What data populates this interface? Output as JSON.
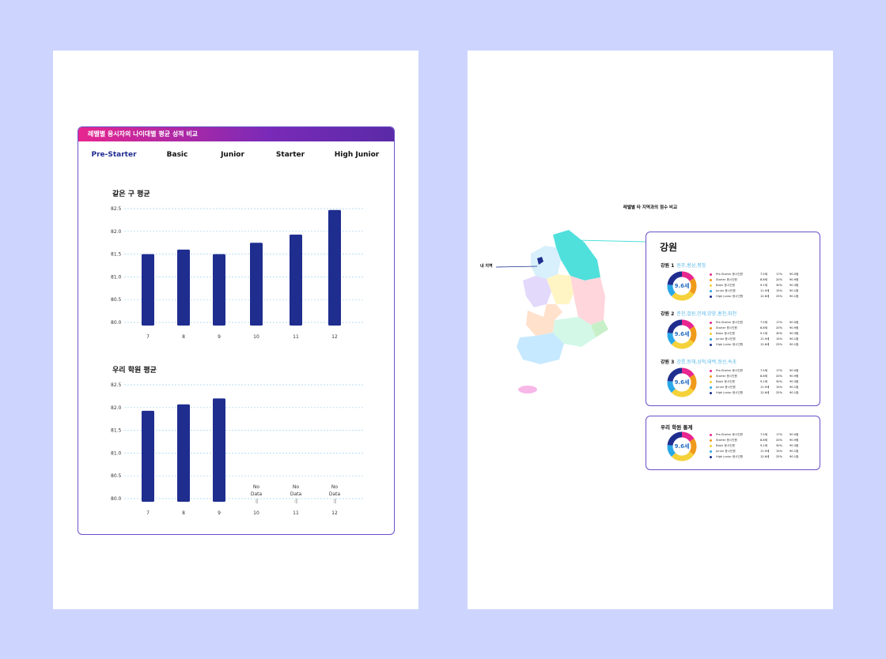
{
  "left_card": {
    "header": "레벨별 응시자의 나이대별 평균 성적 비교",
    "tabs": [
      "Pre-Starter",
      "Basic",
      "Junior",
      "Starter",
      "High Junior"
    ],
    "active_tab": "Pre-Starter",
    "section1_title": "같은 구 평균",
    "section2_title": "우리 학원 평균",
    "no_data_line1": "No",
    "no_data_line2": "Data",
    "no_data_mark": ":|"
  },
  "chart_data": [
    {
      "type": "bar",
      "title": "같은 구 평균",
      "categories": [
        "7",
        "8",
        "9",
        "10",
        "11",
        "12"
      ],
      "values": [
        81.5,
        81.6,
        81.5,
        81.75,
        81.93,
        82.47
      ],
      "yticks": [
        "82.5",
        "82.0",
        "81.5",
        "81.0",
        "80.5",
        "80.0"
      ],
      "ylim": [
        80.0,
        82.5
      ],
      "grid": true,
      "color": "#1f2d8f"
    },
    {
      "type": "bar",
      "title": "우리 학원 평균",
      "categories": [
        "7",
        "8",
        "9",
        "10",
        "11",
        "12"
      ],
      "values": [
        81.93,
        82.07,
        82.2,
        null,
        null,
        null
      ],
      "yticks": [
        "82.5",
        "82.0",
        "81.5",
        "81.0",
        "80.5",
        "80.0"
      ],
      "ylim": [
        80.0,
        82.5
      ],
      "grid": true,
      "color": "#1f2d8f"
    }
  ],
  "right_page": {
    "title": "레벨별 타 지역과의 점수 비교",
    "my_region_label": "내 지역",
    "region_name": "강원",
    "groups": [
      {
        "title": "강원 1",
        "sub": "원주,횡성,평창"
      },
      {
        "title": "강원 2",
        "sub": "춘천,철원,인제,양양,홍천,화천"
      },
      {
        "title": "강원 3",
        "sub": "강릉,동해,삼척,태백,정선,속초"
      }
    ],
    "stats_title": "우리 학원 통계",
    "donut_center": "9.6세",
    "donut_segments": [
      {
        "name": "Pre-Starter",
        "value": 17,
        "color": "#e8268f"
      },
      {
        "name": "Starter",
        "value": 20,
        "color": "#f09a1a"
      },
      {
        "name": "Basic",
        "value": 30,
        "color": "#f5d23a"
      },
      {
        "name": "Junior",
        "value": 15,
        "color": "#2aa8e8"
      },
      {
        "name": "High Junior",
        "value": 25,
        "color": "#1f2d8f"
      }
    ],
    "legend_rows": [
      {
        "name": "Pre-Starter 응시인원",
        "age": "7.5세",
        "pct": "17%",
        "score": "90.0점",
        "color": "#e8268f"
      },
      {
        "name": "Starter 응시인원",
        "age": "8.8세",
        "pct": "20%",
        "score": "90.9점",
        "color": "#f09a1a"
      },
      {
        "name": "Basic 응시인원",
        "age": "9.1세",
        "pct": "30%",
        "score": "90.3점",
        "color": "#f5d23a"
      },
      {
        "name": "Junior 응시인원",
        "age": "11.9세",
        "pct": "15%",
        "score": "90.1점",
        "color": "#2aa8e8"
      },
      {
        "name": "High Junior 응시인원",
        "age": "12.6세",
        "pct": "25%",
        "score": "90.1점",
        "color": "#1f2d8f"
      }
    ]
  }
}
